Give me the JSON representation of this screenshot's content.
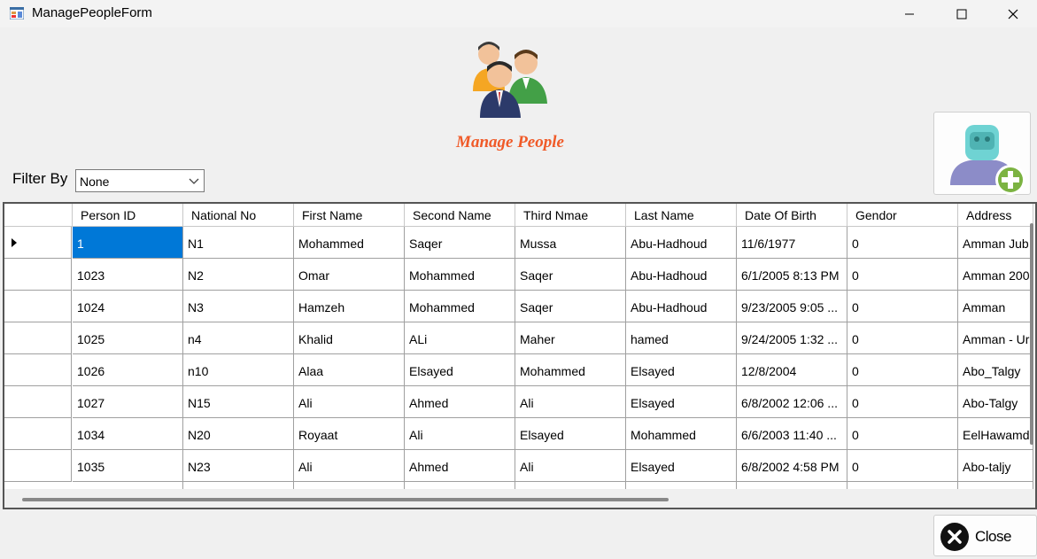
{
  "window": {
    "title": "ManagePeopleForm"
  },
  "header": {
    "heading": "Manage People"
  },
  "filter": {
    "label": "Filter By",
    "selected": "None"
  },
  "close_button": {
    "label": "Close"
  },
  "grid": {
    "columns": [
      "Person ID",
      "National No",
      "First Name",
      "Second Name",
      "Third Nmae",
      "Last Name",
      "Date Of Birth",
      "Gendor",
      "Address"
    ],
    "rows": [
      [
        "1",
        "N1",
        "Mohammed",
        "Saqer",
        "Mussa",
        "Abu-Hadhoud",
        "11/6/1977",
        "0",
        "Amman Jub"
      ],
      [
        "1023",
        "N2",
        "Omar",
        "Mohammed",
        "Saqer",
        "Abu-Hadhoud",
        "6/1/2005 8:13 PM",
        "0",
        "Amman 200"
      ],
      [
        "1024",
        "N3",
        "Hamzeh",
        "Mohammed",
        "Saqer",
        "Abu-Hadhoud",
        "9/23/2005 9:05 ...",
        "0",
        "Amman"
      ],
      [
        "1025",
        "n4",
        "Khalid",
        "ALi",
        "Maher",
        "hamed",
        "9/24/2005 1:32 ...",
        "0",
        "Amman - Ur"
      ],
      [
        "1026",
        "n10",
        "Alaa",
        "Elsayed",
        "Mohammed",
        "Elsayed",
        "12/8/2004",
        "0",
        "Abo_Talgy"
      ],
      [
        "1027",
        "N15",
        "Ali",
        "Ahmed",
        "Ali",
        "Elsayed",
        "6/8/2002 12:06 ...",
        "0",
        "Abo-Talgy"
      ],
      [
        "1034",
        "N20",
        "Royaat",
        "Ali",
        "Elsayed",
        "Mohammed",
        "6/6/2003 11:40 ...",
        "0",
        "EelHawamd"
      ],
      [
        "1035",
        "N23",
        "Ali",
        "Ahmed",
        "Ali",
        "Elsayed",
        "6/8/2002 4:58 PM",
        "0",
        "Abo-taljy"
      ]
    ],
    "selected_cell": {
      "row": 0,
      "col": 0
    }
  },
  "colors": {
    "accent": "#0078d7",
    "heading": "#f05a28"
  },
  "icons": {
    "people": "people-group-icon",
    "add_person": "add-person-icon",
    "close": "close-circle-icon"
  }
}
